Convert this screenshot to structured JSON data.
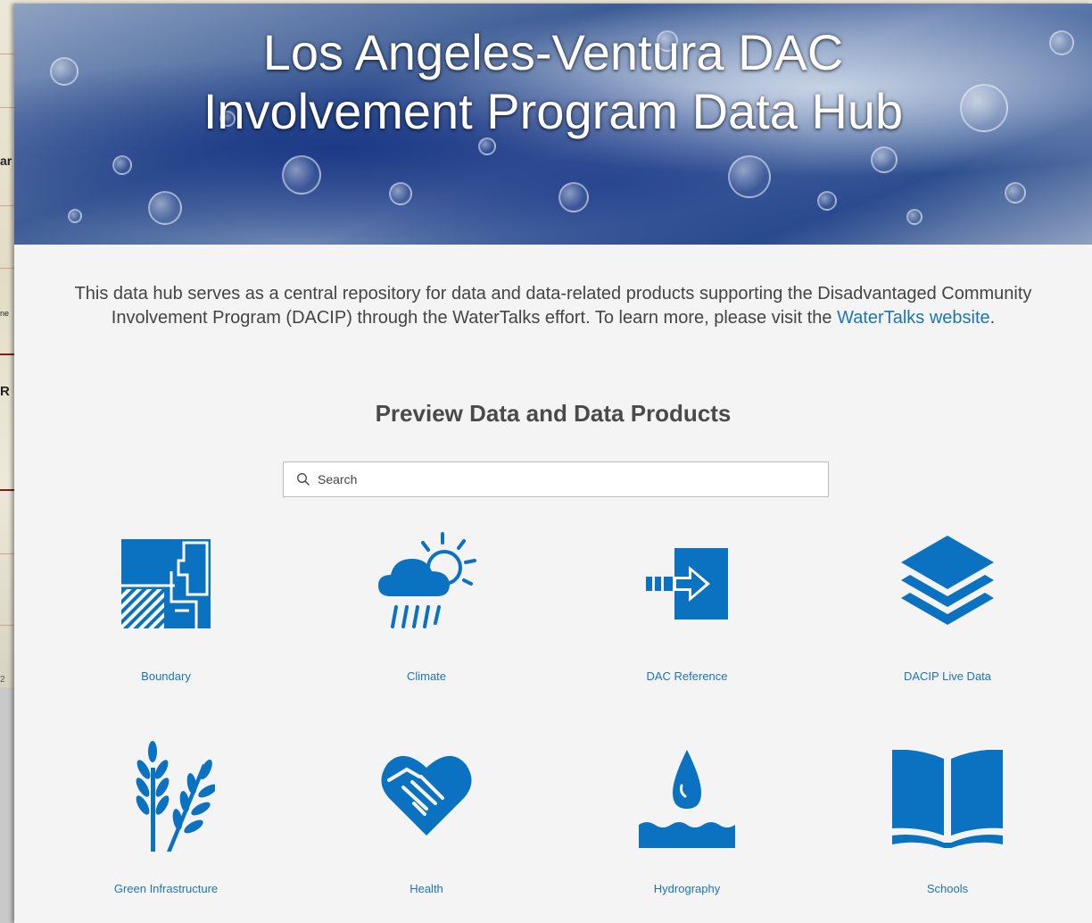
{
  "background": {
    "fragments": [
      "ar",
      "ne",
      "R",
      "2"
    ]
  },
  "hero": {
    "title_line1": "Los Angeles-Ventura DAC",
    "title_line2": "Involvement Program Data Hub"
  },
  "intro": {
    "text_before_link": "This data hub serves as a central repository for data and data-related products supporting the Disadvantaged Community Involvement Program (DACIP) through the WaterTalks effort. To learn more, please visit the ",
    "link_text": "WaterTalks website",
    "text_after_link": "."
  },
  "section": {
    "title": "Preview Data and Data Products"
  },
  "search": {
    "placeholder": "Search"
  },
  "colors": {
    "accent": "#0b72c2",
    "link": "#1c75b7",
    "panel_bg": "#f4f4f4"
  },
  "categories": [
    {
      "label": "Boundary",
      "icon": "boundary-map-icon"
    },
    {
      "label": "Climate",
      "icon": "sun-cloud-rain-icon"
    },
    {
      "label": "DAC Reference",
      "icon": "arrow-into-door-icon"
    },
    {
      "label": "DACIP Live Data",
      "icon": "layers-stack-icon"
    },
    {
      "label": "Green Infrastructure",
      "icon": "wheat-icon"
    },
    {
      "label": "Health",
      "icon": "heart-handshake-icon"
    },
    {
      "label": "Hydrography",
      "icon": "water-drop-icon"
    },
    {
      "label": "Schools",
      "icon": "open-book-icon"
    }
  ]
}
